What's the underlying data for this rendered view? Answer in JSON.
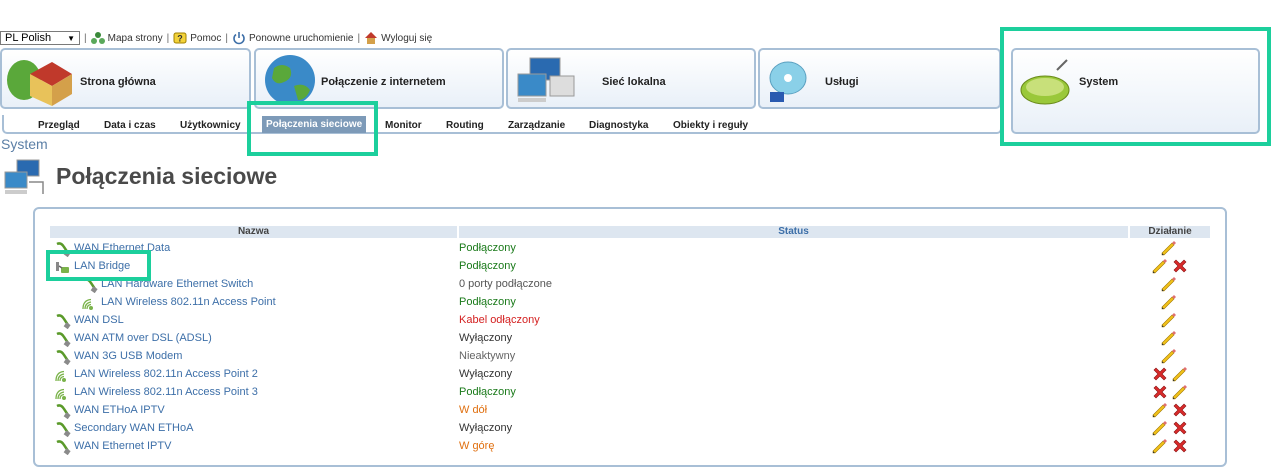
{
  "topbar": {
    "language": "PL Polish",
    "links": [
      "Mapa strony",
      "Pomoc",
      "Ponowne uruchomienie",
      "Wyloguj się"
    ]
  },
  "tabs": [
    {
      "label": "Strona główna",
      "icon": "house-icon"
    },
    {
      "label": "Połączenie z internetem",
      "icon": "globe-icon"
    },
    {
      "label": "Sieć lokalna",
      "icon": "network-computers-icon"
    },
    {
      "label": "Usługi",
      "icon": "disc-icon"
    },
    {
      "label": "System",
      "icon": "router-icon"
    }
  ],
  "subnav": [
    "Przegląd",
    "Data i czas",
    "Użytkownicy",
    "Połączenia sieciowe",
    "Monitor",
    "Routing",
    "Zarządzanie",
    "Diagnostyka",
    "Obiekty i reguły"
  ],
  "breadcrumb": "System",
  "page_title": "Połączenia sieciowe",
  "table": {
    "headers": {
      "name": "Nazwa",
      "status": "Status",
      "action": "Działanie"
    },
    "rows": [
      {
        "name": "WAN Ethernet Data",
        "status": "Podłączony",
        "status_color": "#1a7a1a",
        "icon": "ethernet-cable-icon",
        "indent": 0,
        "actions": [
          "edit"
        ]
      },
      {
        "name": "LAN Bridge",
        "status": "Podłączony",
        "status_color": "#1a7a1a",
        "icon": "bridge-icon",
        "indent": 0,
        "actions": [
          "edit",
          "delete"
        ]
      },
      {
        "name": "LAN Hardware Ethernet Switch",
        "status": "0 porty podłączone",
        "status_color": "#555555",
        "icon": "ethernet-cable-icon",
        "indent": 2,
        "actions": [
          "edit"
        ]
      },
      {
        "name": "LAN Wireless 802.11n Access Point",
        "status": "Podłączony",
        "status_color": "#1a7a1a",
        "icon": "wireless-icon",
        "indent": 2,
        "actions": [
          "edit"
        ]
      },
      {
        "name": "WAN DSL",
        "status": "Kabel odłączony",
        "status_color": "#d42020",
        "icon": "ethernet-cable-icon",
        "indent": 0,
        "actions": [
          "edit"
        ]
      },
      {
        "name": "WAN ATM over DSL (ADSL)",
        "status": "Wyłączony",
        "status_color": "#333333",
        "icon": "ethernet-cable-icon",
        "indent": 0,
        "actions": [
          "edit"
        ]
      },
      {
        "name": "WAN 3G USB Modem",
        "status": "Nieaktywny",
        "status_color": "#666666",
        "icon": "ethernet-cable-icon",
        "indent": 0,
        "actions": [
          "edit"
        ]
      },
      {
        "name": "LAN Wireless 802.11n Access Point 2",
        "status": "Wyłączony",
        "status_color": "#333333",
        "icon": "wireless-icon",
        "indent": 0,
        "actions": [
          "delete",
          "edit"
        ]
      },
      {
        "name": "LAN Wireless 802.11n Access Point 3",
        "status": "Podłączony",
        "status_color": "#1a7a1a",
        "icon": "wireless-icon",
        "indent": 0,
        "actions": [
          "delete",
          "edit"
        ]
      },
      {
        "name": "WAN ETHoA IPTV",
        "status": "W dół",
        "status_color": "#e07010",
        "icon": "ethernet-cable-icon",
        "indent": 0,
        "actions": [
          "edit",
          "delete"
        ]
      },
      {
        "name": "Secondary WAN ETHoA",
        "status": "Wyłączony",
        "status_color": "#333333",
        "icon": "ethernet-cable-icon",
        "indent": 0,
        "actions": [
          "edit",
          "delete"
        ]
      },
      {
        "name": "WAN Ethernet IPTV",
        "status": "W górę",
        "status_color": "#e07010",
        "icon": "ethernet-cable-icon",
        "indent": 0,
        "actions": [
          "edit",
          "delete"
        ]
      }
    ]
  },
  "highlight_color": "#1ccf9c"
}
